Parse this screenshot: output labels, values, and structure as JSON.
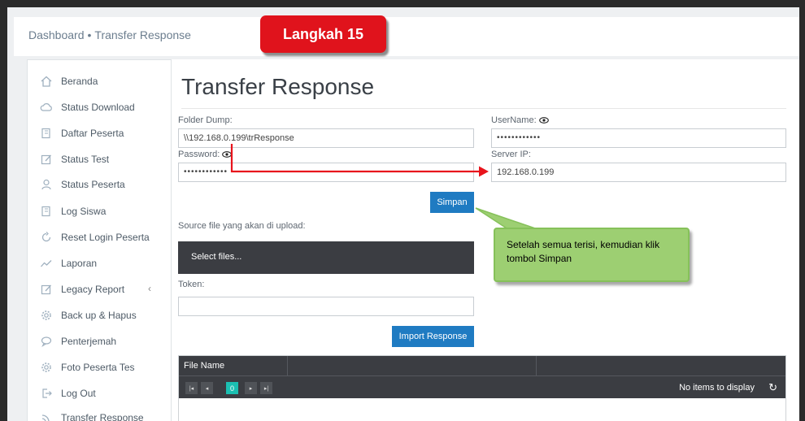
{
  "breadcrumb": {
    "root": "Dashboard",
    "separator": "•",
    "current": "Transfer Response"
  },
  "step_badge": "Langkah 15",
  "sidebar": {
    "items": [
      {
        "label": "Beranda",
        "icon": "home-icon"
      },
      {
        "label": "Status Download",
        "icon": "cloud-icon"
      },
      {
        "label": "Daftar Peserta",
        "icon": "files-icon"
      },
      {
        "label": "Status Test",
        "icon": "edit-icon"
      },
      {
        "label": "Status Peserta",
        "icon": "user-icon"
      },
      {
        "label": "Log Siswa",
        "icon": "files-icon"
      },
      {
        "label": "Reset Login Peserta",
        "icon": "refresh-icon"
      },
      {
        "label": "Laporan",
        "icon": "chart-line-icon"
      },
      {
        "label": "Legacy Report",
        "icon": "edit-icon",
        "chevron": "‹"
      },
      {
        "label": "Back up & Hapus",
        "icon": "gear-icon"
      },
      {
        "label": "Penterjemah",
        "icon": "chat-icon"
      },
      {
        "label": "Foto Peserta Tes",
        "icon": "gear-icon"
      },
      {
        "label": "Log Out",
        "icon": "logout-icon"
      },
      {
        "label": "Transfer Response",
        "icon": "rss-icon"
      }
    ]
  },
  "page": {
    "title": "Transfer Response",
    "folder_dump_label": "Folder Dump:",
    "folder_dump_value": "\\\\192.168.0.199\\trResponse",
    "username_label": "UserName:",
    "username_value": "••••••••••••",
    "password_label": "Password:",
    "password_value": "••••••••••••",
    "server_ip_label": "Server IP:",
    "server_ip_value": "192.168.0.199",
    "save_button": "Simpan",
    "source_label": "Source file yang akan di upload:",
    "select_files": "Select files...",
    "token_label": "Token:",
    "token_value": "",
    "import_button": "Import Response"
  },
  "grid": {
    "columns": [
      "File Name",
      "",
      ""
    ],
    "pager": {
      "first": "|◂",
      "prev": "◂",
      "page": "0",
      "next": "▸",
      "last": "▸|"
    },
    "empty_text": "No items to display",
    "refresh_icon": "↻"
  },
  "callout": "Setelah semua terisi, kemudian klik tombol Simpan",
  "colors": {
    "step_badge": "#e0131c",
    "primary_button": "#1f7bc2",
    "callout": "#9dcf72",
    "arrow": "#e8141c",
    "active_page": "#1bbfb1"
  }
}
